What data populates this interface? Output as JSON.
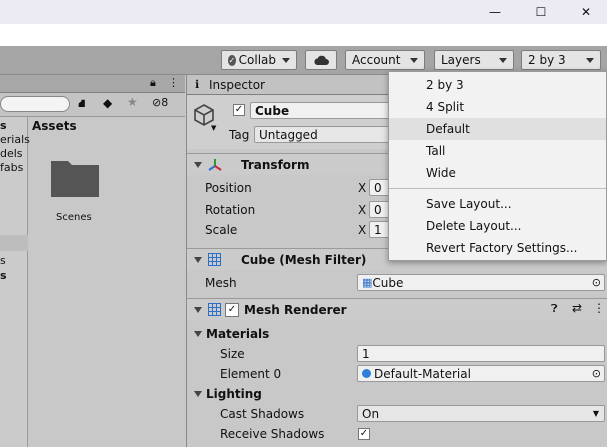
{
  "window": {
    "minimize_glyph": "—",
    "maximize_glyph": "☐",
    "close_glyph": "✕"
  },
  "toolbar": {
    "collab_label": "Collab",
    "account_label": "Account",
    "layers_label": "Layers",
    "layout_label": "2 by 3"
  },
  "left_panel": {
    "eye_count": "8",
    "assets_header": "Assets",
    "tree_items": [
      "s",
      "erials",
      "dels",
      "fabs",
      "",
      "s",
      "s"
    ],
    "folder_label": "Scenes"
  },
  "inspector": {
    "tab_title": "Inspector",
    "object_name": "Cube",
    "tag_label": "Tag",
    "tag_value": "Untagged",
    "transform": {
      "title": "Transform",
      "position_label": "Position",
      "rotation_label": "Rotation",
      "scale_label": "Scale",
      "x_label": "X",
      "position_x": "0",
      "rotation_x": "0",
      "scale_x": "1"
    },
    "mesh_filter": {
      "title": "Cube (Mesh Filter)",
      "mesh_label": "Mesh",
      "mesh_value": "Cube"
    },
    "mesh_renderer": {
      "title": "Mesh Renderer",
      "materials_label": "Materials",
      "size_label": "Size",
      "size_value": "1",
      "element0_label": "Element 0",
      "element0_value": "Default-Material",
      "lighting_label": "Lighting",
      "cast_shadows_label": "Cast Shadows",
      "cast_shadows_value": "On",
      "receive_shadows_label": "Receive Shadows"
    }
  },
  "layout_menu": {
    "items": [
      "2 by 3",
      "4 Split",
      "Default",
      "Tall",
      "Wide"
    ],
    "actions": [
      "Save Layout...",
      "Delete Layout...",
      "Revert Factory Settings..."
    ],
    "highlighted": "Default"
  }
}
